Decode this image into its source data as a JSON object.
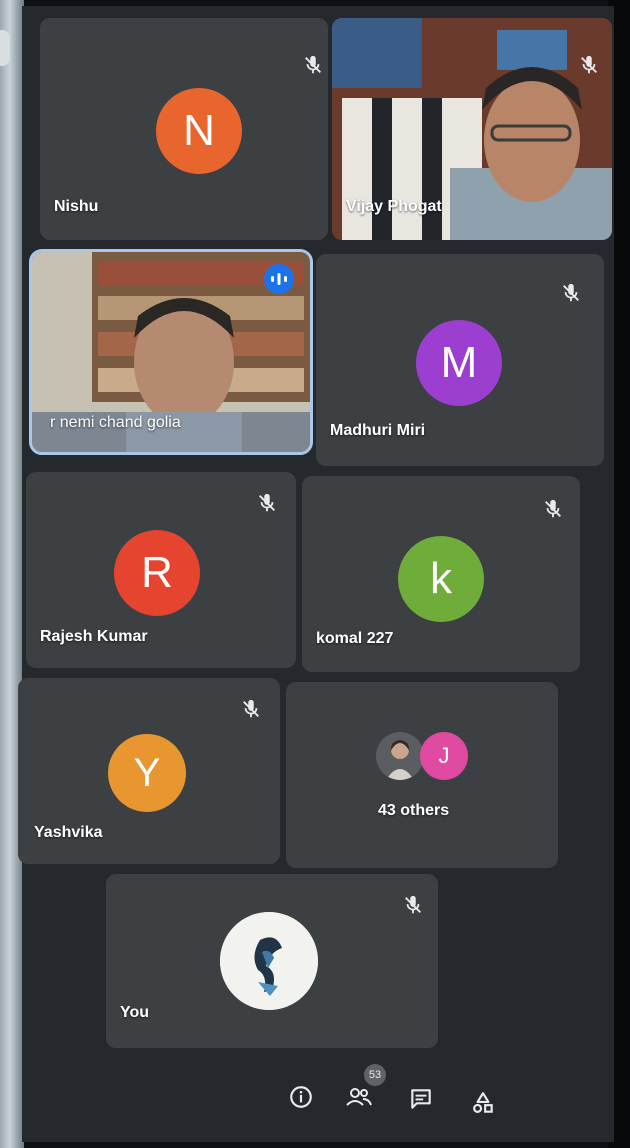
{
  "participants": [
    {
      "name": "Nishu",
      "initial": "N",
      "color": "#e8652e"
    },
    {
      "name": "Vijay Phogat"
    },
    {
      "name": "r nemi chand golia"
    },
    {
      "name": "Madhuri Miri",
      "initial": "M",
      "color": "#9c3fd0"
    },
    {
      "name": "Rajesh Kumar",
      "initial": "R",
      "color": "#e5452f"
    },
    {
      "name": "komal 227",
      "initial": "k",
      "color": "#6fac3a"
    },
    {
      "name": "Yashvika",
      "initial": "Y",
      "color": "#e8962f"
    }
  ],
  "others": {
    "label": "43 others",
    "initial": "J",
    "color": "#e04aa0"
  },
  "self": {
    "label": "You"
  },
  "toolbar": {
    "people_count": "53"
  },
  "icons": {
    "mute": "mic-off-icon",
    "speaking": "audio-level-icon",
    "info": "info-icon",
    "people": "people-icon",
    "chat": "chat-icon",
    "activities": "activities-icon"
  },
  "colors": {
    "screen_bg": "#25282c",
    "tile_bg": "#3c4043",
    "active_outline": "#a9c7e8",
    "speaking_badge": "#1a73e8"
  }
}
